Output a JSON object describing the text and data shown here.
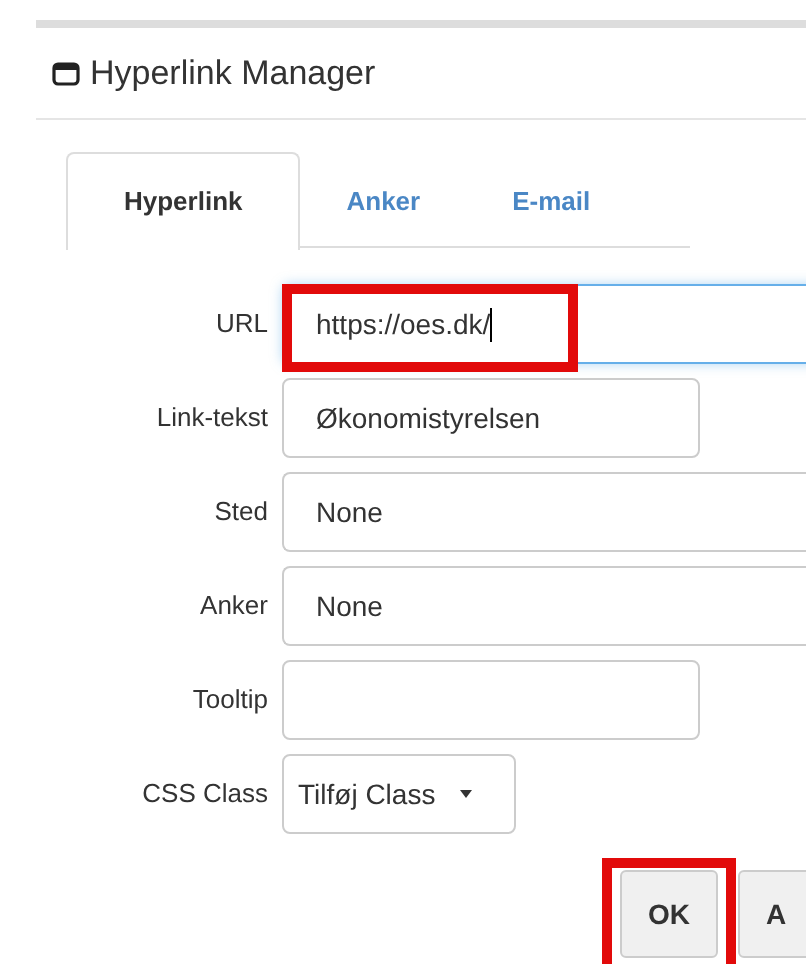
{
  "window": {
    "title": "Hyperlink Manager"
  },
  "tabs": [
    {
      "label": "Hyperlink",
      "selected": true
    },
    {
      "label": "Anker",
      "selected": false
    },
    {
      "label": "E-mail",
      "selected": false
    }
  ],
  "fields": [
    {
      "label": "URL",
      "kind": "wide",
      "value": "https://oes.dk/",
      "focused": true,
      "highlighted": true
    },
    {
      "label": "Link-tekst",
      "kind": "short",
      "value": "Økonomistyrelsen",
      "focused": false,
      "highlighted": false
    },
    {
      "label": "Sted",
      "kind": "wide",
      "value": "None",
      "focused": false,
      "highlighted": false
    },
    {
      "label": "Anker",
      "kind": "wide",
      "value": "None",
      "focused": false,
      "highlighted": false
    },
    {
      "label": "Tooltip",
      "kind": "short",
      "focused": false,
      "highlighted": false
    },
    {
      "label": "CSS Class",
      "kind": "dropdown",
      "value": "Tilføj Class",
      "focused": false,
      "highlighted": false
    }
  ],
  "buttons": [
    {
      "label": "OK",
      "highlighted": true
    },
    {
      "label": "A",
      "highlighted": false
    }
  ]
}
